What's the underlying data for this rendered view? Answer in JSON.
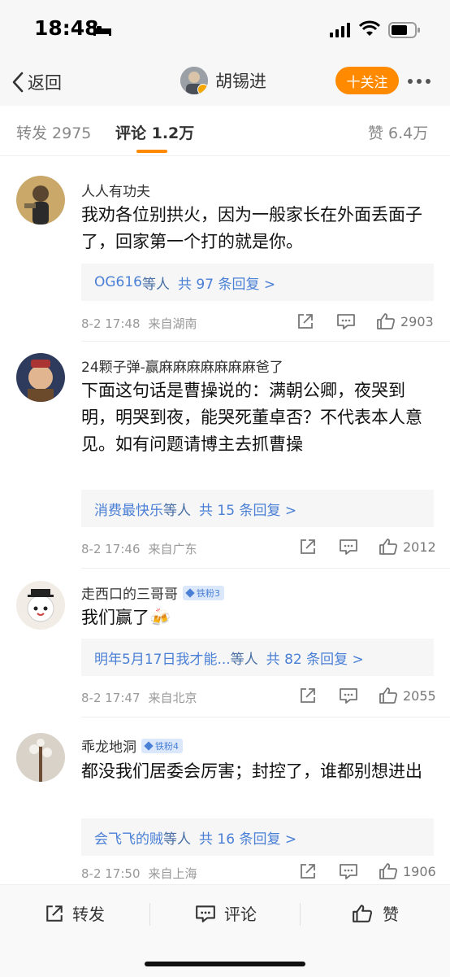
{
  "status_bar": {
    "time": "18:48"
  },
  "nav": {
    "back_label": "返回",
    "user_name": "胡锡进",
    "follow_label": "十关注"
  },
  "tabs": {
    "repost": "转发 2975",
    "comment": "评论 1.2万",
    "like": "赞 6.4万"
  },
  "comments": [
    {
      "username": "人人有功夫",
      "badge": "",
      "text": "我劝各位别拱火，因为一般家长在外面丢面子了，回家第一个打的就是你。",
      "reply_names": "OG616",
      "reply_mid": "等人",
      "reply_count": "共 97 条回复 >",
      "time": "8-2 17:48",
      "location": "来自湖南",
      "likes": "2903"
    },
    {
      "username": "24颗子弹-赢麻麻麻麻麻麻麻爸了",
      "badge": "",
      "text": "下面这句话是曹操说的：满朝公卿，夜哭到明，明哭到夜，能哭死董卓否？不代表本人意见。如有问题请博主去抓曹操",
      "reply_names": "消费最快乐",
      "reply_mid": "等人",
      "reply_count": "共 15 条回复 >",
      "time": "8-2 17:46",
      "location": "来自广东",
      "likes": "2012"
    },
    {
      "username": "走西口的三哥哥",
      "badge": "铁粉3",
      "text": "我们赢了🍻",
      "reply_names": "明年5月17日我才能...",
      "reply_mid": "等人",
      "reply_count": "共 82 条回复 >",
      "time": "8-2 17:47",
      "location": "来自北京",
      "likes": "2055"
    },
    {
      "username": "乖龙地洞",
      "badge": "铁粉4",
      "text": "都没我们居委会厉害；封控了，谁都别想进出",
      "reply_names": "会飞飞的贼",
      "reply_mid": "等人",
      "reply_count": "共 16 条回复 >",
      "time": "8-2 17:50",
      "location": "来自上海",
      "likes": "1906"
    }
  ],
  "bottom_bar": {
    "repost": "转发",
    "comment": "评论",
    "like": "赞"
  },
  "colors": {
    "accent": "#ff8a00",
    "link": "#4a7fd6"
  }
}
